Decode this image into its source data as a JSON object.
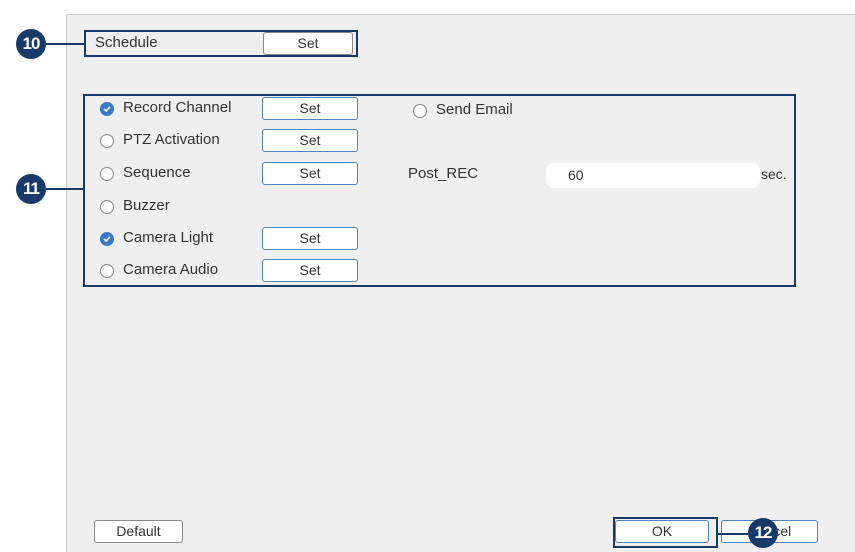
{
  "schedule": {
    "label": "Schedule",
    "button": "Set"
  },
  "options": [
    {
      "label": "Record Channel",
      "checked": true,
      "button": "Set"
    },
    {
      "label": "PTZ Activation",
      "checked": false,
      "button": "Set"
    },
    {
      "label": "Sequence",
      "checked": false,
      "button": "Set"
    },
    {
      "label": "Buzzer",
      "checked": false,
      "button": ""
    },
    {
      "label": "Camera Light",
      "checked": true,
      "button": "Set"
    },
    {
      "label": "Camera Audio",
      "checked": false,
      "button": "Set"
    }
  ],
  "send_email": {
    "label": "Send Email",
    "checked": false
  },
  "post_rec": {
    "label": "Post_REC",
    "value": "60",
    "unit": "sec."
  },
  "footer": {
    "default": "Default",
    "ok": "OK",
    "cancel": "Cancel"
  },
  "callouts": {
    "c10": "10",
    "c11": "11",
    "c12": "12"
  },
  "colors": {
    "accent": "#3b78c9",
    "callout": "#173a6b"
  }
}
